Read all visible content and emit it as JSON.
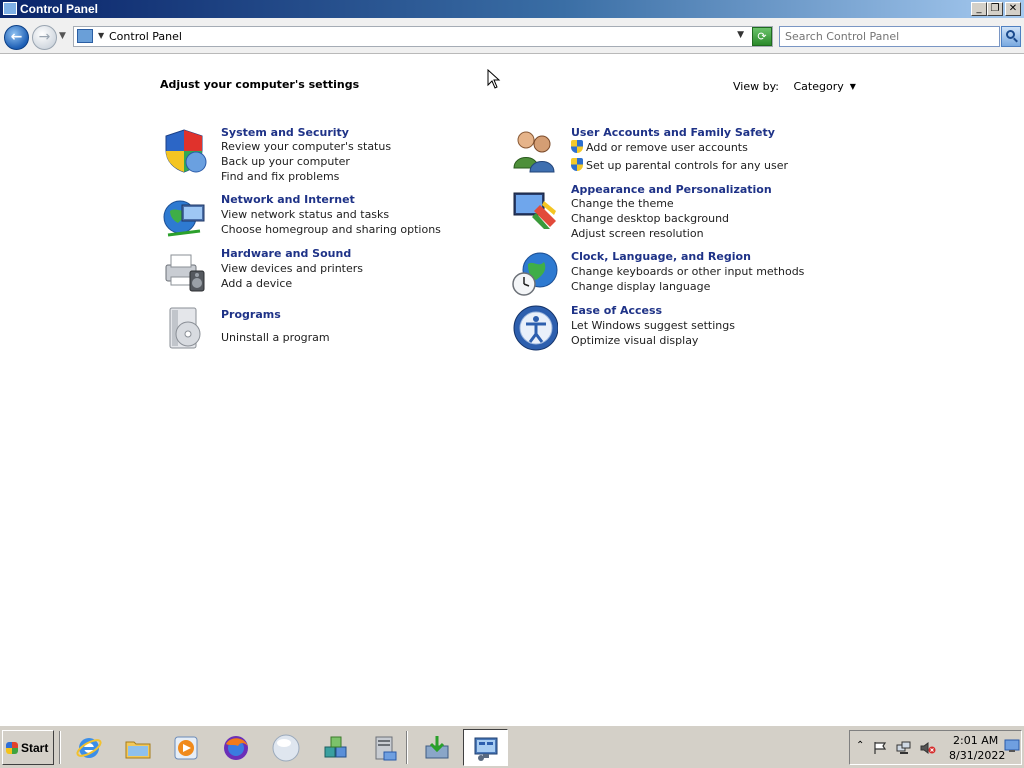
{
  "window": {
    "title": "Control Panel",
    "buttons": {
      "minimize": "_",
      "restore": "❐",
      "close": "✕"
    }
  },
  "addressbar": {
    "path": "Control Panel",
    "search_placeholder": "Search Control Panel"
  },
  "content": {
    "heading": "Adjust your computer's settings",
    "view_by_label": "View by:",
    "view_by_value": "Category"
  },
  "categories": [
    {
      "icon": "shield-icon",
      "title": "System and Security",
      "links": [
        "Review your computer's status",
        "Back up your computer",
        "Find and fix problems"
      ]
    },
    {
      "icon": "globe-network-icon",
      "title": "Network and Internet",
      "links": [
        "View network status and tasks",
        "Choose homegroup and sharing options"
      ]
    },
    {
      "icon": "printer-speaker-icon",
      "title": "Hardware and Sound",
      "links": [
        "View devices and printers",
        "Add a device"
      ]
    },
    {
      "icon": "programs-disc-icon",
      "title": "Programs",
      "links": [
        "Uninstall a program"
      ]
    },
    {
      "icon": "users-icon",
      "title": "User Accounts and Family Safety",
      "links": [
        "Add or remove user accounts",
        "Set up parental controls for any user"
      ]
    },
    {
      "icon": "monitor-palette-icon",
      "title": "Appearance and Personalization",
      "links": [
        "Change the theme",
        "Change desktop background",
        "Adjust screen resolution"
      ]
    },
    {
      "icon": "clock-globe-icon",
      "title": "Clock, Language, and Region",
      "links": [
        "Change keyboards or other input methods",
        "Change display language"
      ]
    },
    {
      "icon": "ease-of-access-icon",
      "title": "Ease of Access",
      "links": [
        "Let Windows suggest settings",
        "Optimize visual display"
      ]
    }
  ],
  "taskbar": {
    "start_label": "Start",
    "apps": [
      "internet-explorer-icon",
      "file-explorer-icon",
      "media-player-icon",
      "firefox-icon",
      "blank-orb-icon",
      "puzzle-cubes-icon",
      "server-icon",
      "installer-icon",
      "control-panel-icon"
    ],
    "clock_time": "2:01 AM",
    "clock_date": "8/31/2022"
  }
}
